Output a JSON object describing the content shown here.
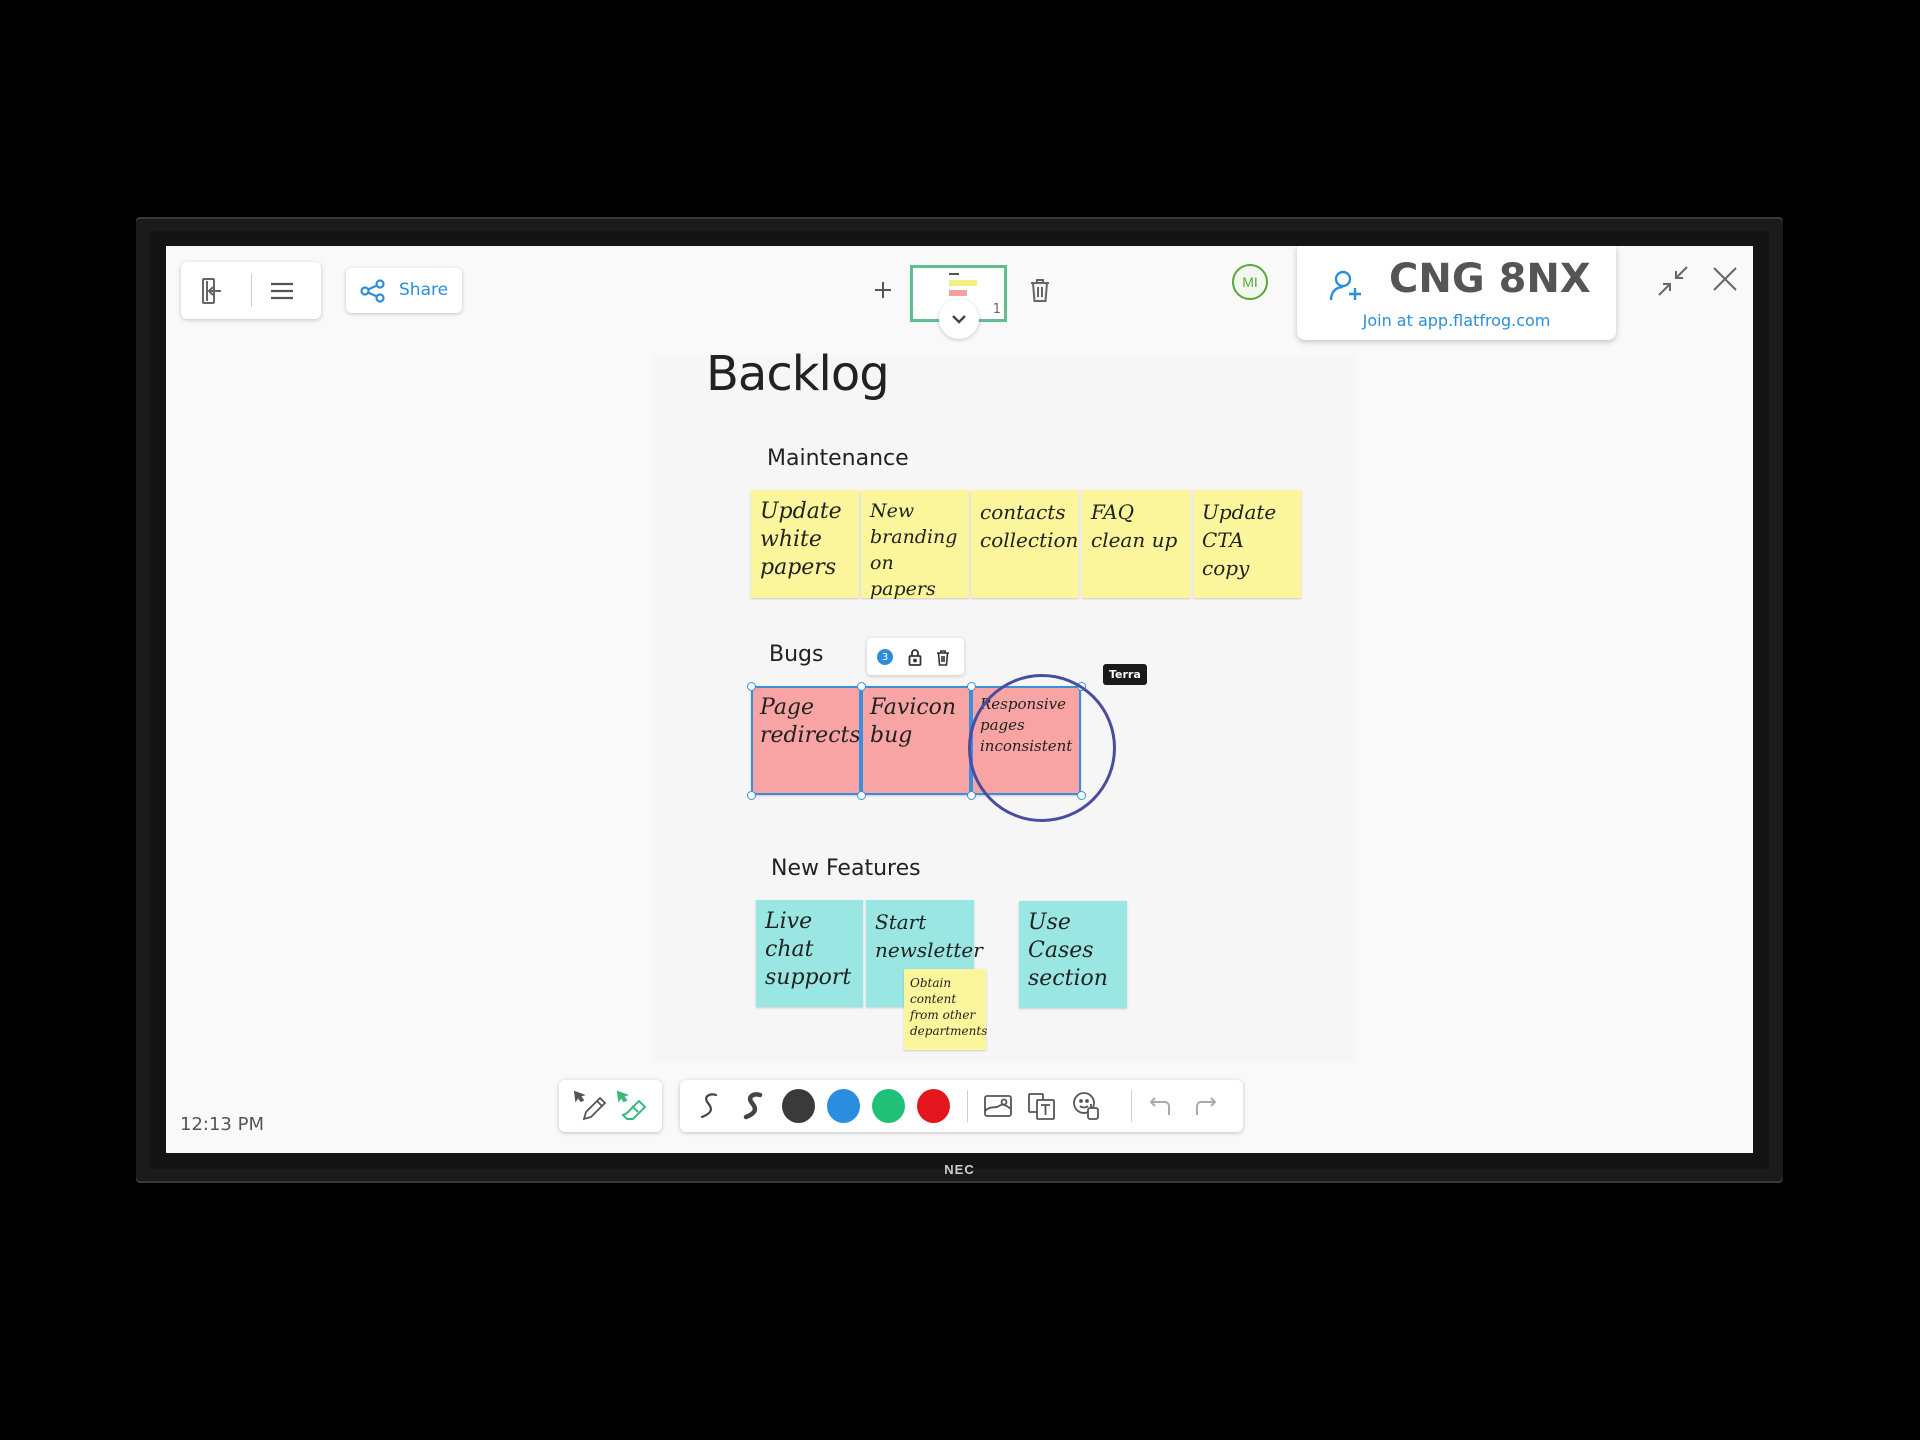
{
  "device": {
    "brand": "NEC"
  },
  "top_left_toolbar": {
    "exit_icon": "exit-door-icon",
    "menu_icon": "hamburger-menu-icon",
    "share_label": "Share",
    "share_icon": "share-nodes-icon"
  },
  "pages": {
    "add_label": "+",
    "current_page": "1",
    "expand_icon": "chevron-down-icon",
    "delete_icon": "trash-icon"
  },
  "session": {
    "user_initials": "MI",
    "room_code": "CNG 8NX",
    "join_text": "Join at app.flatfrog.com",
    "add_user_icon": "add-user-icon"
  },
  "window": {
    "collapse_icon": "collapse-arrows-icon",
    "close_icon": "close-icon"
  },
  "board": {
    "title": "Backlog",
    "sections": [
      {
        "title": "Maintenance",
        "color": "#fbf59c",
        "notes": [
          "Update white papers",
          "New branding on papers",
          "contacts collection",
          "FAQ clean up",
          "Update CTA copy"
        ]
      },
      {
        "title": "Bugs",
        "color": "#f8a4a4",
        "notes": [
          "Page redirects",
          "Favicon bug",
          "Responsive pages inconsistent"
        ]
      },
      {
        "title": "New Features",
        "color": "#9ae6e3",
        "notes": [
          "Live chat support",
          "Start newsletter",
          "Use Cases section"
        ],
        "sub_note": "Obtain content from other departments"
      }
    ],
    "selection": {
      "count": "3",
      "lock_icon": "lock-icon",
      "delete_icon": "trash-icon"
    },
    "cursor_label": "Terra",
    "annotation_circle_color": "#4a4c9e"
  },
  "bottom_toolbar": {
    "modes": [
      {
        "name": "pen-select-mode",
        "icon": "pen-cursor-icon"
      },
      {
        "name": "eraser-select-mode",
        "icon": "eraser-cursor-icon",
        "active": true
      }
    ],
    "pens": [
      {
        "name": "thin-pen",
        "icon": "thin-stroke-icon"
      },
      {
        "name": "thick-pen",
        "icon": "thick-stroke-icon"
      }
    ],
    "colors": [
      {
        "name": "black",
        "hex": "#3a3a3a"
      },
      {
        "name": "blue",
        "hex": "#2b8de0"
      },
      {
        "name": "green",
        "hex": "#20c078"
      },
      {
        "name": "red",
        "hex": "#e3161e"
      }
    ],
    "insert": [
      {
        "name": "insert-image",
        "icon": "image-icon"
      },
      {
        "name": "insert-template",
        "icon": "template-text-icon"
      },
      {
        "name": "insert-sticker",
        "icon": "sticker-icon"
      }
    ],
    "history": [
      {
        "name": "undo",
        "icon": "undo-icon"
      },
      {
        "name": "redo",
        "icon": "redo-icon"
      }
    ]
  },
  "status": {
    "time": "12:13 PM"
  }
}
